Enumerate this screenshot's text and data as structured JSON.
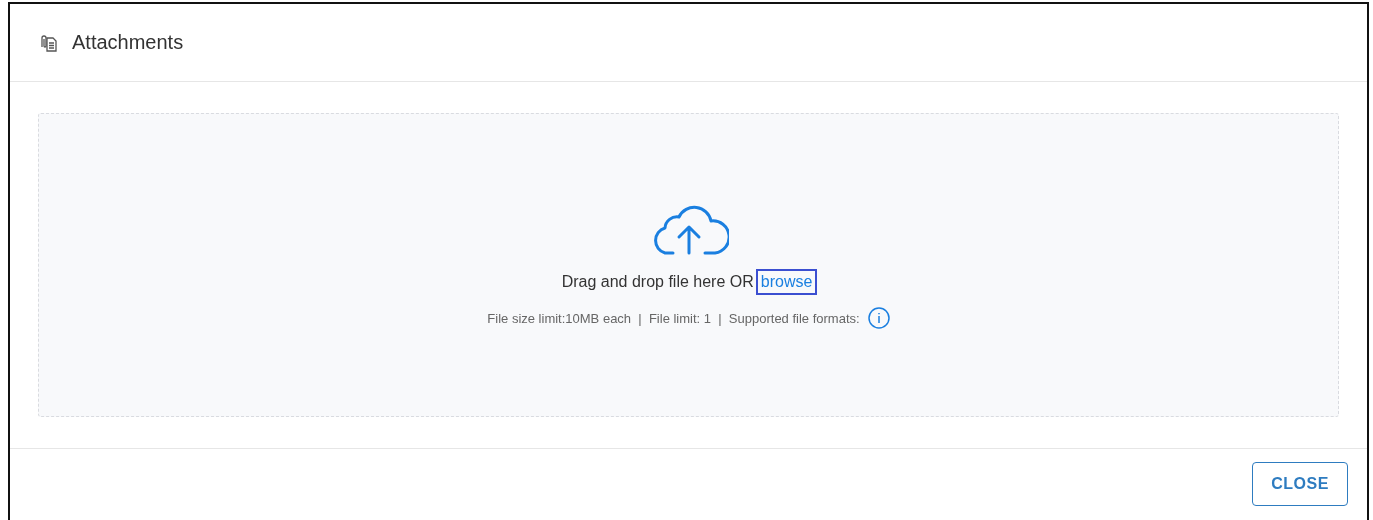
{
  "dialog": {
    "title": "Attachments"
  },
  "dropzone": {
    "prompt": "Drag and drop file here OR",
    "link": {
      "label": "browse",
      "focused": true
    },
    "limits": "File size limit:10MB each  |  File limit: 1  |  Supported file formats:"
  },
  "footer": {
    "buttons": [
      {
        "label": "CLOSE",
        "kind": "outlined"
      }
    ]
  }
}
